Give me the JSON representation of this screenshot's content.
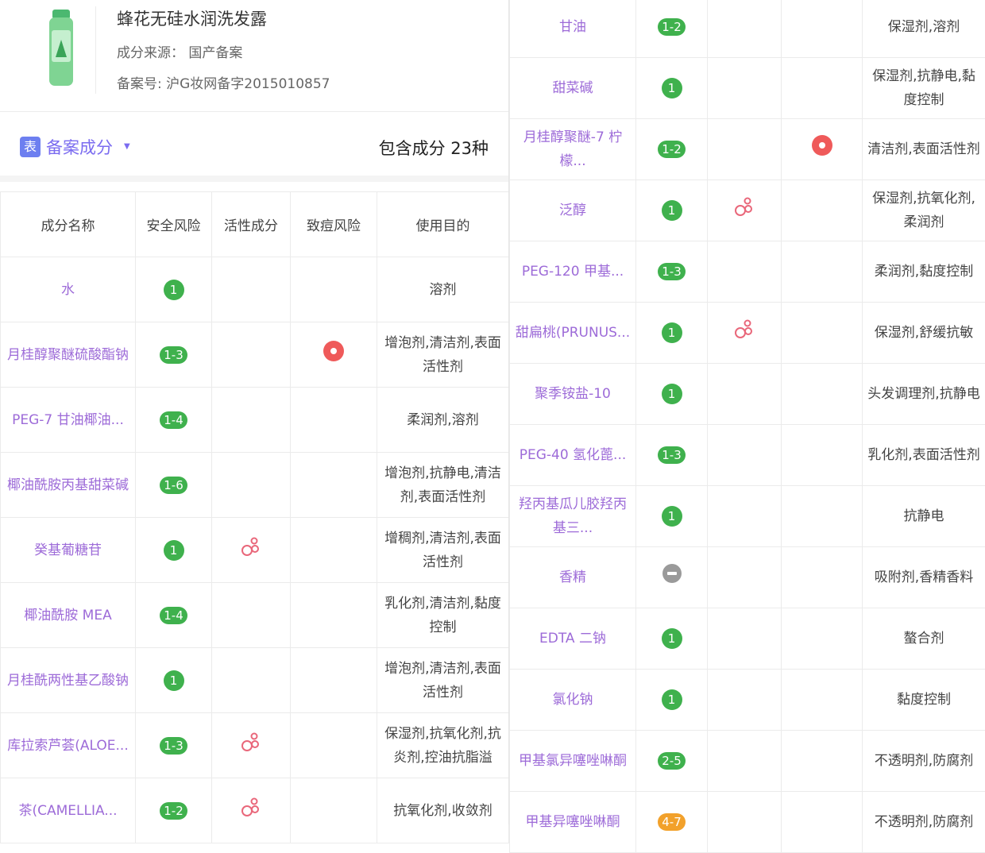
{
  "product": {
    "name": "蜂花无硅水润洗发露",
    "source": "成分来源： 国产备案",
    "filing": "备案号: 沪G妆网备字2015010857"
  },
  "section": {
    "icon_text": "表",
    "title": "备案成分",
    "caret": "▼",
    "count": "包含成分 23种"
  },
  "headers": [
    "成分名称",
    "安全风险",
    "活性成分",
    "致痘风险",
    "使用目的"
  ],
  "left_rows": [
    {
      "name": "水",
      "risk": "1",
      "active": false,
      "acne": false,
      "purpose": "溶剂"
    },
    {
      "name": "月桂醇聚醚硫酸酯钠",
      "risk": "1-3",
      "active": false,
      "acne": true,
      "purpose": "增泡剂,清洁剂,表面活性剂"
    },
    {
      "name": "PEG-7 甘油椰油...",
      "risk": "1-4",
      "active": false,
      "acne": false,
      "purpose": "柔润剂,溶剂"
    },
    {
      "name": "椰油酰胺丙基甜菜碱",
      "risk": "1-6",
      "active": false,
      "acne": false,
      "purpose": "增泡剂,抗静电,清洁剂,表面活性剂"
    },
    {
      "name": "癸基葡糖苷",
      "risk": "1",
      "active": true,
      "acne": false,
      "purpose": "增稠剂,清洁剂,表面活性剂"
    },
    {
      "name": "椰油酰胺 MEA",
      "risk": "1-4",
      "active": false,
      "acne": false,
      "purpose": "乳化剂,清洁剂,黏度控制"
    },
    {
      "name": "月桂酰两性基乙酸钠",
      "risk": "1",
      "active": false,
      "acne": false,
      "purpose": "增泡剂,清洁剂,表面活性剂"
    },
    {
      "name": "库拉索芦荟(ALOE...",
      "risk": "1-3",
      "active": true,
      "acne": false,
      "purpose": "保湿剂,抗氧化剂,抗炎剂,控油抗脂溢"
    },
    {
      "name": "茶(CAMELLIA...",
      "risk": "1-2",
      "active": true,
      "acne": false,
      "purpose": "抗氧化剂,收敛剂"
    }
  ],
  "right_rows": [
    {
      "name": "甘油",
      "risk": "1-2",
      "active": false,
      "acne": false,
      "purpose": "保湿剂,溶剂"
    },
    {
      "name": "甜菜碱",
      "risk": "1",
      "active": false,
      "acne": false,
      "purpose": "保湿剂,抗静电,黏度控制"
    },
    {
      "name": "月桂醇聚醚-7 柠檬...",
      "risk": "1-2",
      "active": false,
      "acne": true,
      "purpose": "清洁剂,表面活性剂"
    },
    {
      "name": "泛醇",
      "risk": "1",
      "active": true,
      "acne": false,
      "purpose": "保湿剂,抗氧化剂,柔润剂"
    },
    {
      "name": "PEG-120 甲基...",
      "risk": "1-3",
      "active": false,
      "acne": false,
      "purpose": "柔润剂,黏度控制"
    },
    {
      "name": "甜扁桃(PRUNUS...",
      "risk": "1",
      "active": true,
      "acne": false,
      "purpose": "保湿剂,舒缓抗敏"
    },
    {
      "name": "聚季铵盐-10",
      "risk": "1",
      "active": false,
      "acne": false,
      "purpose": "头发调理剂,抗静电"
    },
    {
      "name": "PEG-40 氢化蓖...",
      "risk": "1-3",
      "active": false,
      "acne": false,
      "purpose": "乳化剂,表面活性剂"
    },
    {
      "name": "羟丙基瓜儿胶羟丙基三...",
      "risk": "1",
      "active": false,
      "acne": false,
      "purpose": "抗静电"
    },
    {
      "name": "香精",
      "risk": "none",
      "active": false,
      "acne": false,
      "purpose": "吸附剂,香精香料"
    },
    {
      "name": "EDTA 二钠",
      "risk": "1",
      "active": false,
      "acne": false,
      "purpose": "螯合剂"
    },
    {
      "name": "氯化钠",
      "risk": "1",
      "active": false,
      "acne": false,
      "purpose": "黏度控制"
    },
    {
      "name": "甲基氯异噻唑啉酮",
      "risk": "2-5",
      "active": false,
      "acne": false,
      "purpose": "不透明剂,防腐剂"
    },
    {
      "name": "甲基异噻唑啉酮",
      "risk": "4-7",
      "active": false,
      "acne": false,
      "purpose": "不透明剂,防腐剂"
    }
  ],
  "colors": {
    "name": "#9d6bd8",
    "risk_green": "#3fb14d",
    "risk_orange": "#f2a12b",
    "acne_red": "#ef5a5a"
  }
}
